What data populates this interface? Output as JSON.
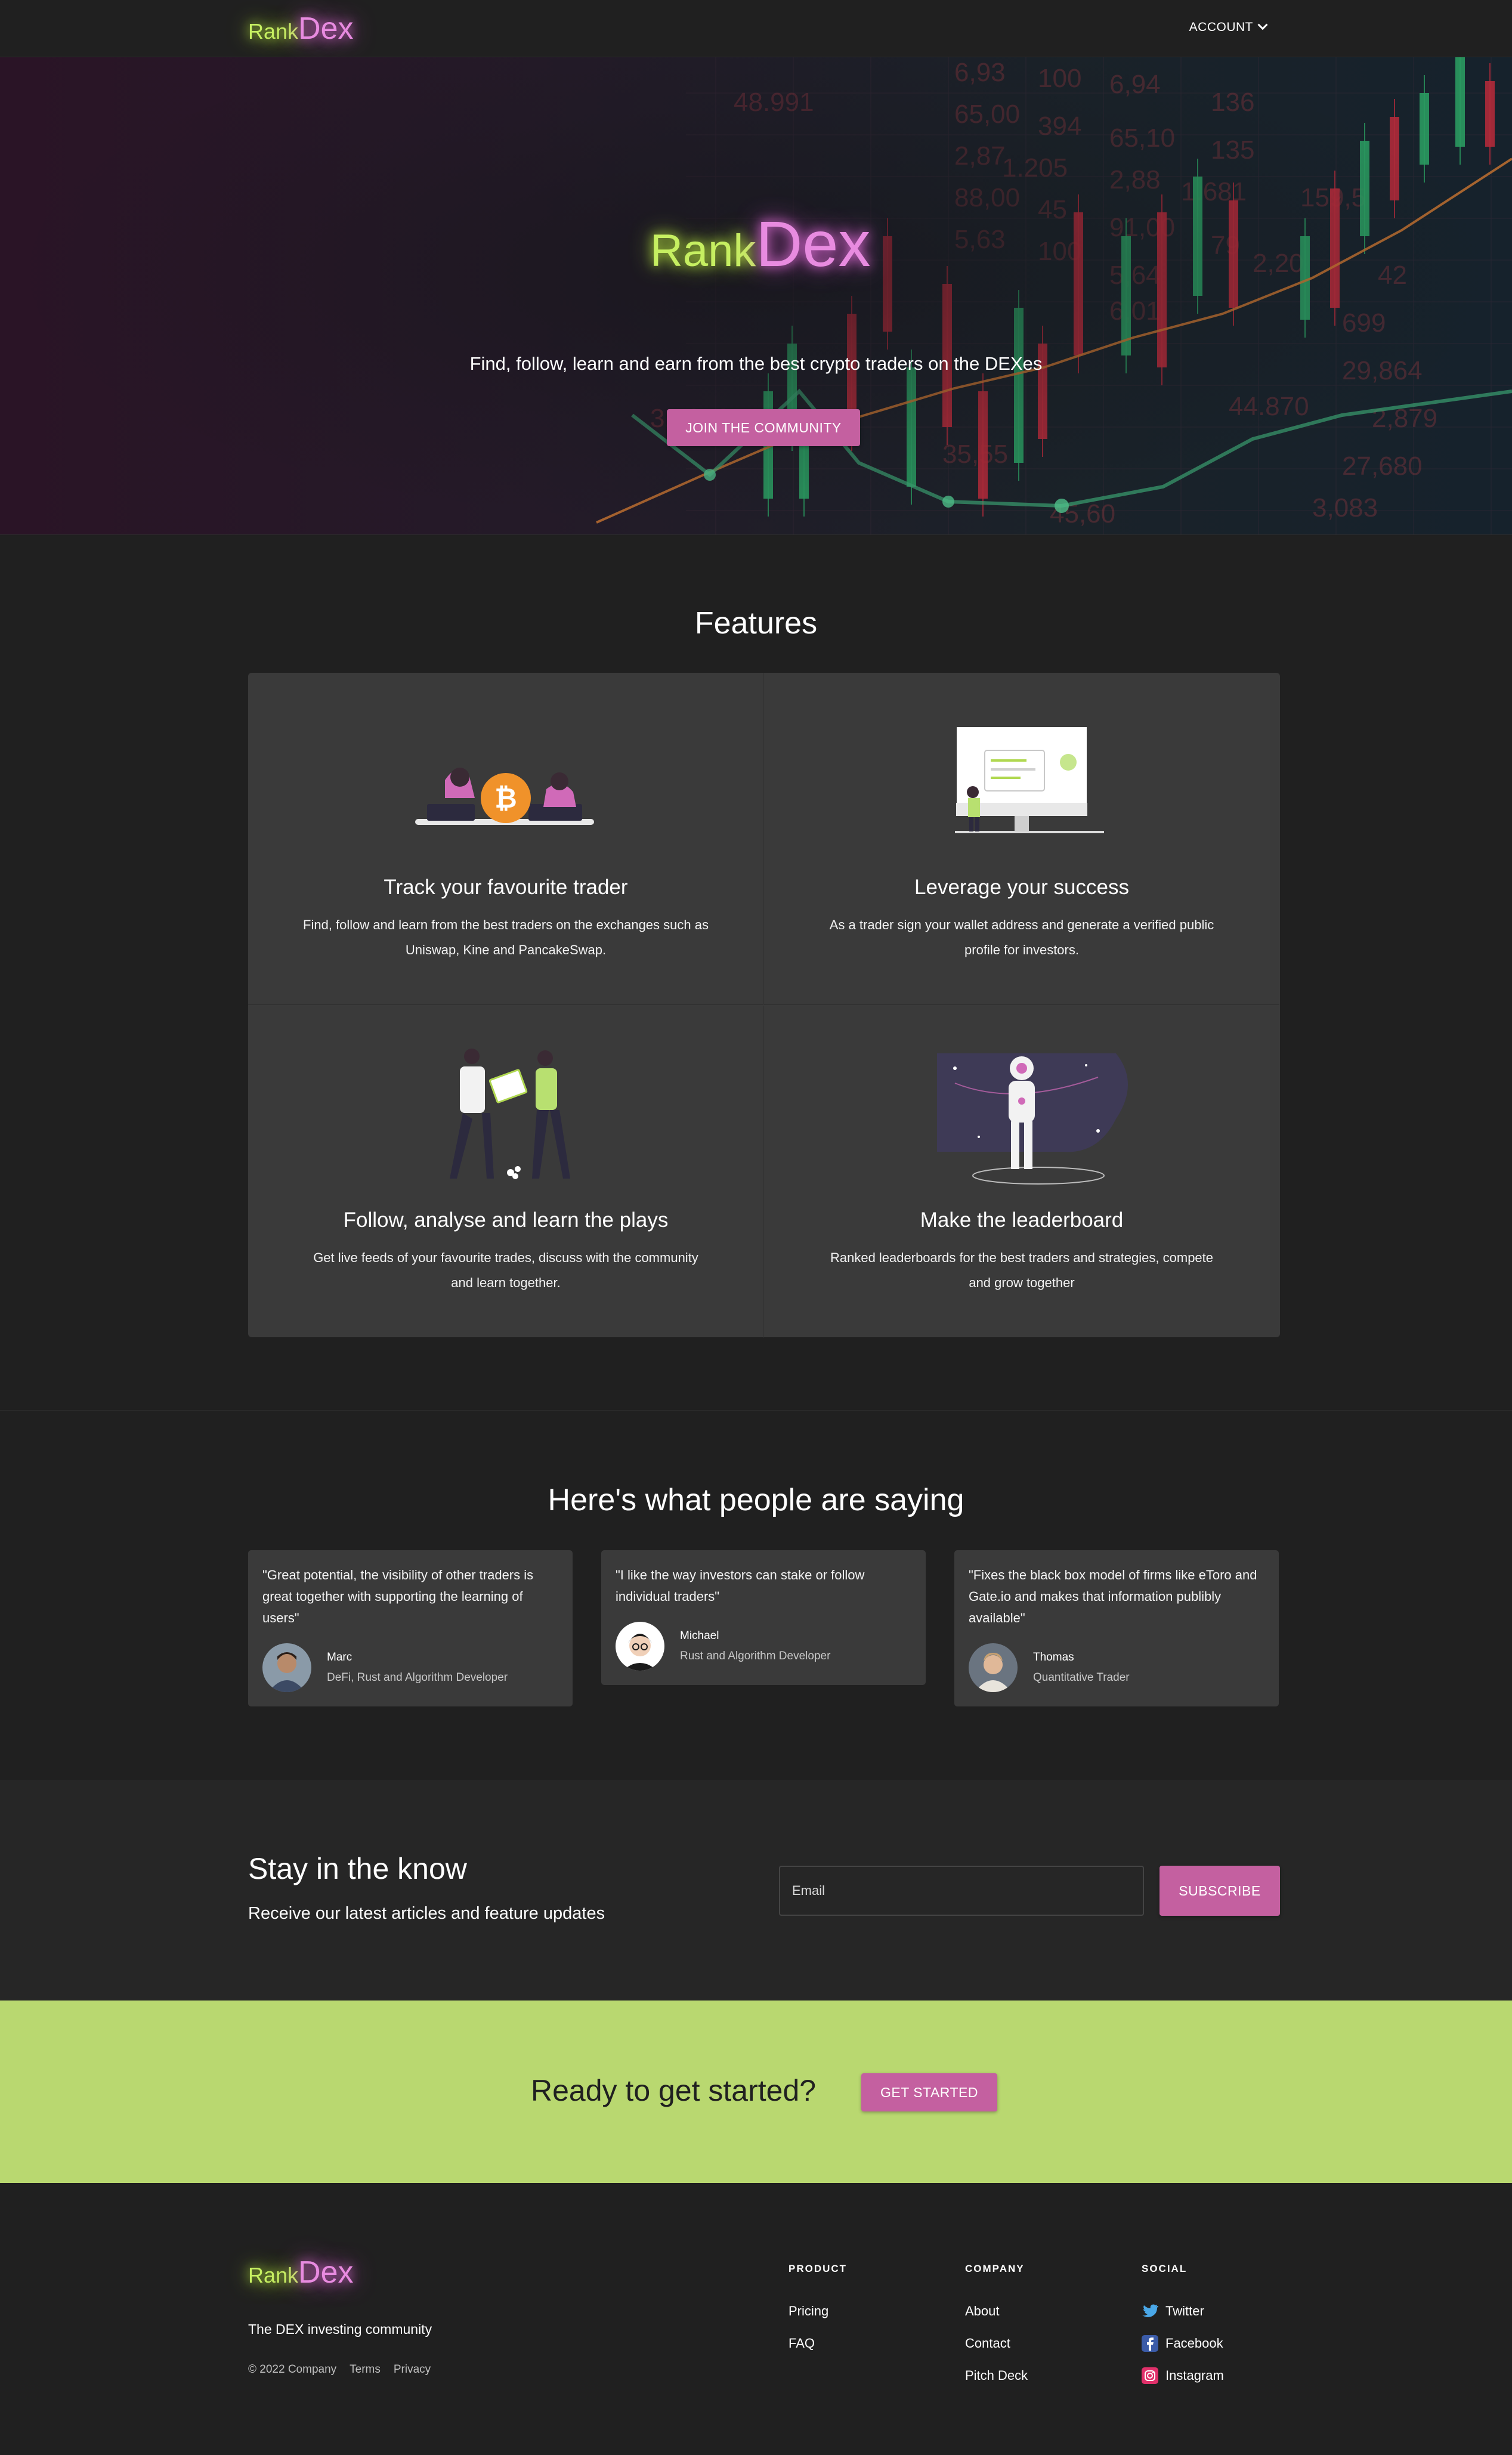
{
  "nav": {
    "logo_rank": "Rank",
    "logo_dex": "Dex",
    "account_label": "ACCOUNT"
  },
  "hero": {
    "logo_rank": "Rank",
    "logo_dex": "Dex",
    "subtitle": "Find, follow, learn and earn from the best crypto traders on the DEXes",
    "cta_label": "JOIN THE COMMUNITY",
    "bg_numbers": [
      "48.991",
      "6,93",
      "100",
      "6,94",
      "136",
      "65,00",
      "394",
      "65,10",
      "135",
      "2,87",
      "1.205",
      "2,88",
      "1.681",
      "88,00",
      "45",
      "91,00",
      "79",
      "5,63",
      "100",
      "5,64",
      "2,20",
      "6,01",
      "44.870",
      "29,864",
      "31,012",
      "35,55",
      "45,60",
      "27,680",
      "2,879",
      "699",
      "42",
      "159,5",
      "3,083"
    ]
  },
  "features": {
    "title": "Features",
    "items": [
      {
        "title": "Track your favourite trader",
        "text": "Find, follow and learn from the best traders on the exchanges such as Uniswap, Kine and PancakeSwap.",
        "icon": "bitcoin-traders-illustration"
      },
      {
        "title": "Leverage your success",
        "text": "As a trader sign your wallet address and generate a verified public profile for investors.",
        "icon": "monitor-dashboard-illustration"
      },
      {
        "title": "Follow, analyse and learn the plays",
        "text": "Get live feeds of your favourite trades, discuss with the community and learn together.",
        "icon": "people-sharing-chart-illustration"
      },
      {
        "title": "Make the leaderboard",
        "text": "Ranked leaderboards for the best traders and strategies, compete and grow together",
        "icon": "astronaut-illustration"
      }
    ]
  },
  "testimonials": {
    "title": "Here's what people are saying",
    "items": [
      {
        "quote": "\"Great potential, the visibility of other traders is great together with supporting the learning of users\"",
        "name": "Marc",
        "role": "DeFi, Rust and Algorithm Developer"
      },
      {
        "quote": "\"I like the way investors can stake or follow individual traders\"",
        "name": "Michael",
        "role": "Rust and Algorithm Developer"
      },
      {
        "quote": "\"Fixes the black box model of firms like eToro and Gate.io and makes that information publibly available\"",
        "name": "Thomas",
        "role": "Quantitative Trader"
      }
    ]
  },
  "newsletter": {
    "title": "Stay in the know",
    "subtitle": "Receive our latest articles and feature updates",
    "email_placeholder": "Email",
    "button_label": "SUBSCRIBE"
  },
  "cta": {
    "text": "Ready to get started?",
    "button_label": "GET STARTED"
  },
  "footer": {
    "logo_rank": "Rank",
    "logo_dex": "Dex",
    "tagline": "The DEX investing community",
    "copyright": "© 2022 Company",
    "terms": "Terms",
    "privacy": "Privacy",
    "columns": [
      {
        "heading": "PRODUCT",
        "links": [
          "Pricing",
          "FAQ"
        ]
      },
      {
        "heading": "COMPANY",
        "links": [
          "About",
          "Contact",
          "Pitch Deck"
        ]
      },
      {
        "heading": "SOCIAL",
        "links": [
          "Twitter",
          "Facebook",
          "Instagram"
        ]
      }
    ]
  },
  "colors": {
    "accent_pink": "#c460a0",
    "logo_green": "#c6ef61",
    "logo_pink": "#e88be0",
    "cta_green": "#b9d870",
    "card_bg": "#3a3a3a",
    "page_bg": "#202020"
  }
}
